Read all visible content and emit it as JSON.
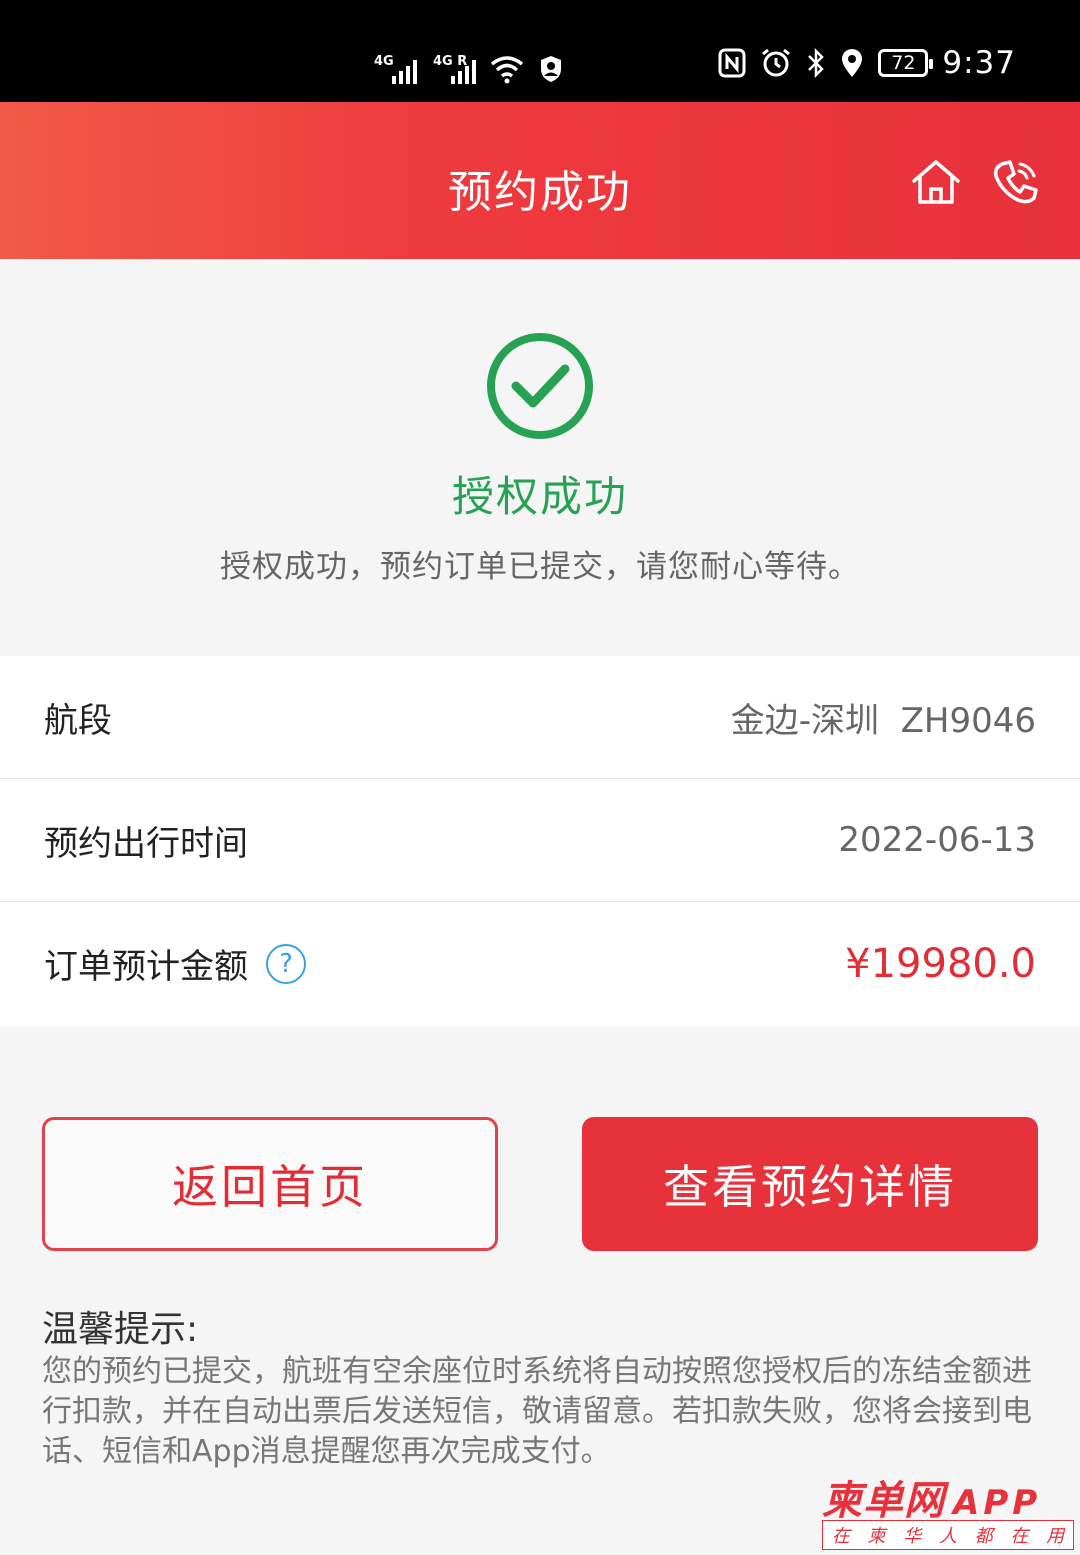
{
  "status_bar": {
    "network_1": "4G",
    "network_2": "4G R",
    "battery": "72",
    "time": "9:37"
  },
  "header": {
    "title": "预约成功",
    "icons": [
      "home-icon",
      "phone-icon"
    ]
  },
  "success": {
    "icon": "check-circle-icon",
    "title": "授权成功",
    "description": "授权成功，预约订单已提交，请您耐心等待。"
  },
  "info": {
    "segment_label": "航段",
    "segment_value": "金边-深圳  ZH9046",
    "date_label": "预约出行时间",
    "date_value": "2022-06-13",
    "amount_label": "订单预计金额",
    "amount_help": "?",
    "amount_value": "¥19980.0"
  },
  "buttons": {
    "back_home": "返回首页",
    "view_detail": "查看预约详情"
  },
  "tips": {
    "title": "温馨提示:",
    "body": "您的预约已提交，航班有空余座位时系统将自动按照您授权后的冻结金额进行扣款，并在自动出票后发送短信，敬请留意。若扣款失败，您将会接到电话、短信和App消息提醒您再次完成支付。"
  },
  "watermark": {
    "logo": "柬单网",
    "app": "APP",
    "slogan": [
      "在",
      "柬",
      "华",
      "人",
      "都",
      "在",
      "用"
    ]
  },
  "colors": {
    "header_red": "#ef3a3e",
    "success_green": "#27a255",
    "price_red": "#e12d36",
    "help_blue": "#3aa0dc"
  }
}
